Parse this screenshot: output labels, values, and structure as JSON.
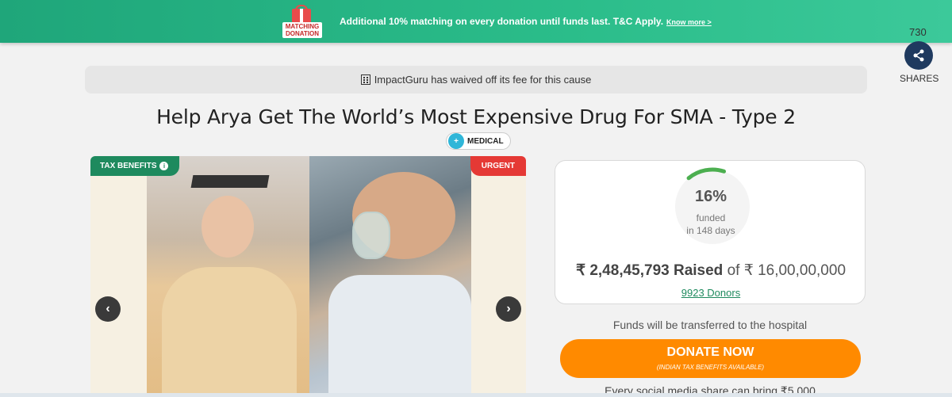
{
  "banner": {
    "gift_label": "MATCHING DONATION",
    "text": "Additional 10% matching on every donation until funds last. T&C Apply.",
    "link": "Know more >"
  },
  "shares": {
    "count": "730",
    "label": "SHARES"
  },
  "notice": {
    "text": "ImpactGuru has waived off its fee for this cause"
  },
  "campaign": {
    "title": "Help Arya Get The World’s Most Expensive Drug For SMA - Type 2",
    "category": "MEDICAL"
  },
  "carousel": {
    "tax_benefits": "TAX BENEFITS",
    "urgent": "URGENT",
    "prev": "‹",
    "next": "›"
  },
  "funding": {
    "percent": "16%",
    "percent_value": 0.16,
    "funded_label": "funded",
    "days": "in 148 days",
    "raised": "₹ 2,48,45,793 Raised",
    "of_goal": "of ₹ 16,00,00,000",
    "donors": "9923 Donors"
  },
  "transfer_note": "Funds will be transferred to the hospital",
  "donate": {
    "label": "DONATE NOW",
    "sublabel": "(INDIAN TAX BENEFITS AVAILABLE)"
  },
  "social_note": "Every social media share can bring ₹5,000",
  "colors": {
    "banner": "#2bbd8a",
    "donate": "#ff8a00",
    "urgent": "#e53935",
    "tax": "#1e8a5e",
    "share": "#1f3a5f"
  }
}
